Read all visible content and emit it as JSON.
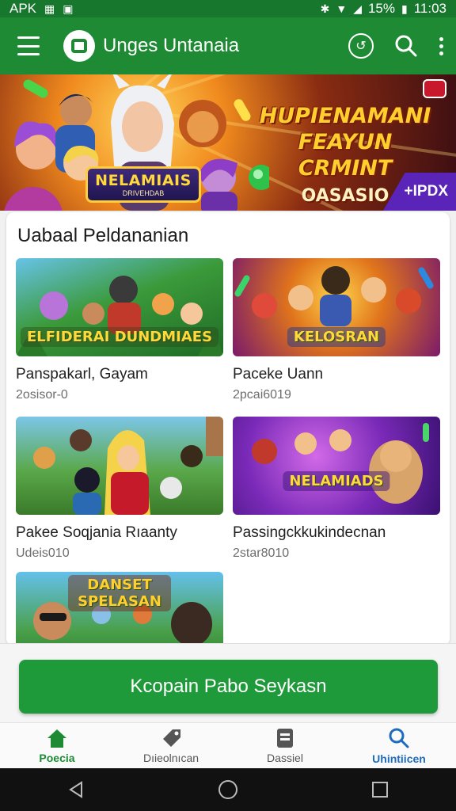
{
  "status_bar": {
    "left_text": "APK",
    "battery": "15%",
    "time": "11:03"
  },
  "app_bar": {
    "title": "Unges Untanaia",
    "icons": [
      "menu-icon",
      "app-logo",
      "refresh-circle-icon",
      "search-icon",
      "more-vert-icon"
    ]
  },
  "banner": {
    "logo_main": "NELAMIAIS",
    "logo_sub": "DRIVEHDAB",
    "promo_line1": "HUPIENAMANI",
    "promo_line2": "FEAYUN CRMINT",
    "promo_line3": "OASASIO",
    "tag": "+IPDX"
  },
  "section": {
    "title": "Uabaal Peldananian",
    "games": [
      {
        "thumb_text": "ELFIDERAI DUNDMIAES",
        "name": "Panspakarl, Gayam",
        "sub": "2osisor-0"
      },
      {
        "thumb_text": "KELOSRAN",
        "name": "Paceke Uann",
        "sub": "2pcai6019"
      },
      {
        "thumb_text": "",
        "name": "Pakee Soqjania Rıaanty",
        "sub": "Udeis010"
      },
      {
        "thumb_text": "NELAMIADS",
        "name": "Passingckkukindecnan",
        "sub": "2star8010"
      },
      {
        "thumb_text": "DANSET SPELASAN",
        "name": "",
        "sub": ""
      }
    ]
  },
  "cta": {
    "label": "Kcopain Pabo Seykasn"
  },
  "bottom_nav": {
    "items": [
      {
        "label": "Poecia",
        "icon": "home-icon"
      },
      {
        "label": "Dıieolnıcan",
        "icon": "tag-icon"
      },
      {
        "label": "Dassiel",
        "icon": "document-icon"
      },
      {
        "label": "Uhintiicen",
        "icon": "search-icon"
      }
    ]
  },
  "colors": {
    "primary": "#1e8b34",
    "cta": "#1f9a3b",
    "accent_blue": "#1e6cbf"
  }
}
